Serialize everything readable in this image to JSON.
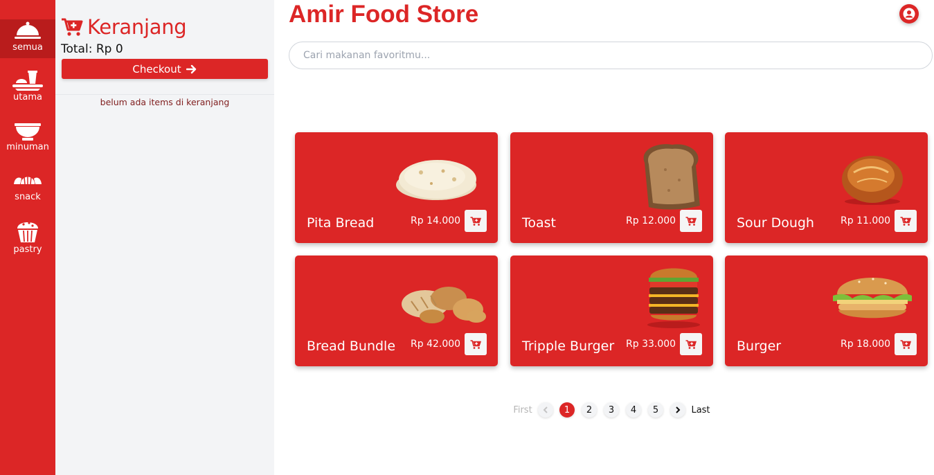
{
  "colors": {
    "accent": "#dc2626",
    "accent_dark": "#b91c1c",
    "panel": "#f3f4f6"
  },
  "categories": [
    {
      "label": "semua",
      "icon": "cloche-icon"
    },
    {
      "label": "utama",
      "icon": "meal-icon"
    },
    {
      "label": "minuman",
      "icon": "bowl-icon"
    },
    {
      "label": "snack",
      "icon": "bread-icon"
    },
    {
      "label": "pastry",
      "icon": "cupcake-icon"
    }
  ],
  "cart": {
    "title": "Keranjang",
    "total": "Total: Rp 0",
    "checkout_label": "Checkout",
    "empty_text": "belum ada items di keranjang"
  },
  "header": {
    "brand": "Amir Food Store",
    "search_placeholder": "Cari makanan favoritmu..."
  },
  "products": [
    {
      "name": "Pita Bread",
      "price": "Rp 14.000"
    },
    {
      "name": "Toast",
      "price": "Rp 12.000"
    },
    {
      "name": "Sour Dough",
      "price": "Rp 11.000"
    },
    {
      "name": "Bread Bundle",
      "price": "Rp 42.000"
    },
    {
      "name": "Tripple Burger",
      "price": "Rp 33.000"
    },
    {
      "name": "Burger",
      "price": "Rp 18.000"
    }
  ],
  "pagination": {
    "first": "First",
    "last": "Last",
    "pages": [
      "1",
      "2",
      "3",
      "4",
      "5"
    ],
    "current": "1"
  }
}
